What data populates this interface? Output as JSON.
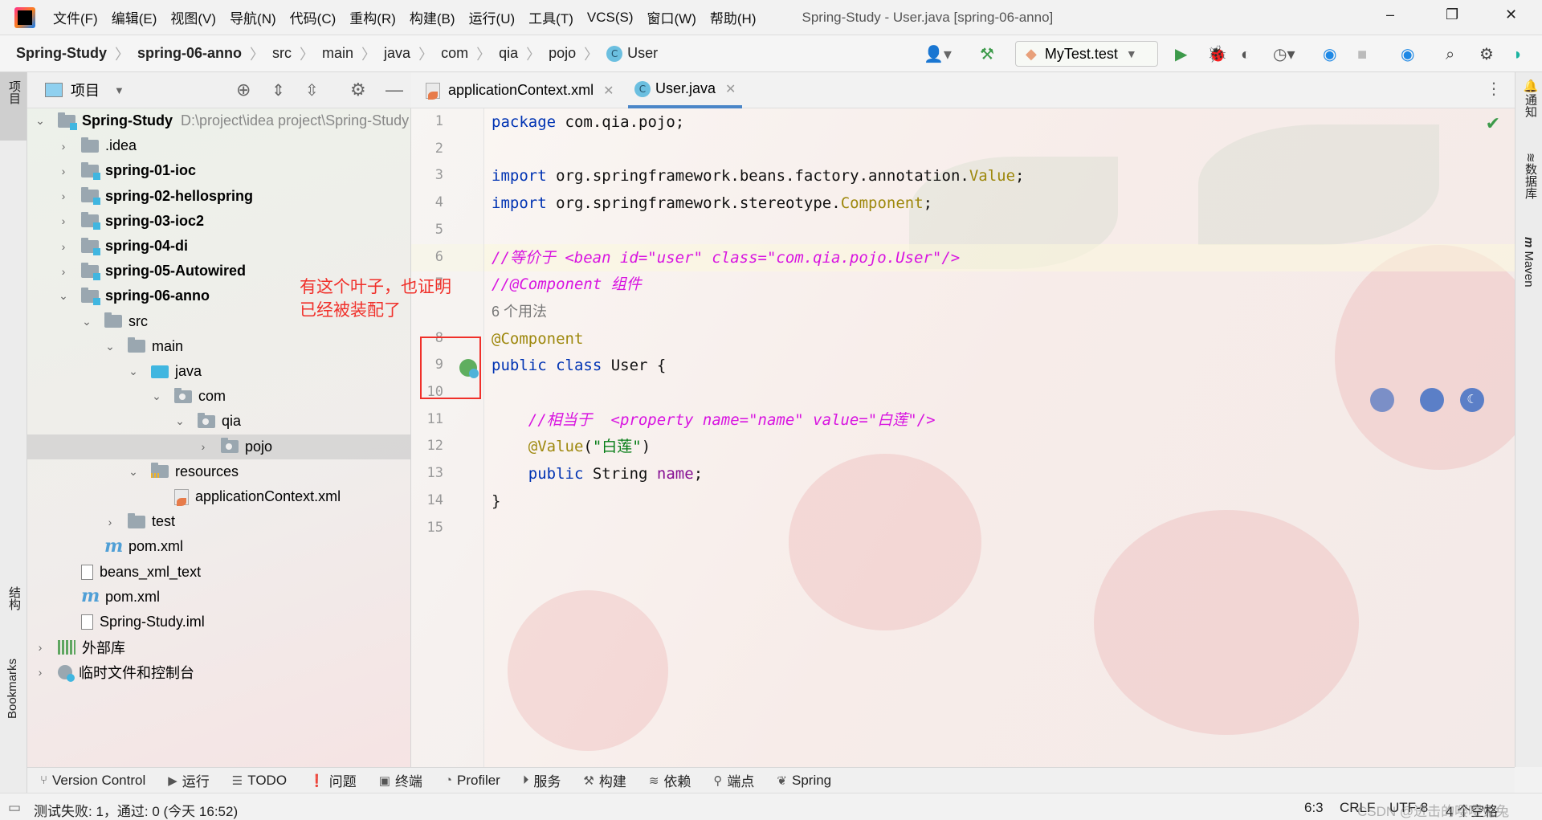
{
  "titlebar": {
    "menus": [
      "文件(F)",
      "编辑(E)",
      "视图(V)",
      "导航(N)",
      "代码(C)",
      "重构(R)",
      "构建(B)",
      "运行(U)",
      "工具(T)",
      "VCS(S)",
      "窗口(W)",
      "帮助(H)"
    ],
    "window_title": "Spring-Study - User.java [spring-06-anno]"
  },
  "breadcrumb": [
    "Spring-Study",
    "spring-06-anno",
    "src",
    "main",
    "java",
    "com",
    "qia",
    "pojo",
    "User"
  ],
  "toolbar": {
    "run_config": "MyTest.test"
  },
  "left_strip": {
    "project": "项目",
    "structure": "结构",
    "bookmarks": "Bookmarks"
  },
  "right_strip": {
    "notifications": "通知",
    "database": "数据库",
    "maven": "Maven"
  },
  "project_panel": {
    "title": "项目",
    "tree": [
      {
        "label": "Spring-Study",
        "path": "D:\\project\\idea project\\Spring-Study",
        "level": 0,
        "arrow": "down",
        "icon": "module",
        "bold": true
      },
      {
        "label": ".idea",
        "level": 1,
        "arrow": "right",
        "icon": "folder"
      },
      {
        "label": "spring-01-ioc",
        "level": 1,
        "arrow": "right",
        "icon": "module",
        "bold": true
      },
      {
        "label": "spring-02-hellospring",
        "level": 1,
        "arrow": "right",
        "icon": "module",
        "bold": true
      },
      {
        "label": "spring-03-ioc2",
        "level": 1,
        "arrow": "right",
        "icon": "module",
        "bold": true
      },
      {
        "label": "spring-04-di",
        "level": 1,
        "arrow": "right",
        "icon": "module",
        "bold": true
      },
      {
        "label": "spring-05-Autowired",
        "level": 1,
        "arrow": "right",
        "icon": "module",
        "bold": true
      },
      {
        "label": "spring-06-anno",
        "level": 1,
        "arrow": "down",
        "icon": "module",
        "bold": true
      },
      {
        "label": "src",
        "level": 2,
        "arrow": "down",
        "icon": "folder"
      },
      {
        "label": "main",
        "level": 3,
        "arrow": "down",
        "icon": "folder"
      },
      {
        "label": "java",
        "level": 4,
        "arrow": "down",
        "icon": "srcfolder"
      },
      {
        "label": "com",
        "level": 5,
        "arrow": "down",
        "icon": "pkg"
      },
      {
        "label": "qia",
        "level": 6,
        "arrow": "down",
        "icon": "pkg"
      },
      {
        "label": "pojo",
        "level": 7,
        "arrow": "right",
        "icon": "pkg",
        "selected": true
      },
      {
        "label": "resources",
        "level": 4,
        "arrow": "down",
        "icon": "res"
      },
      {
        "label": "applicationContext.xml",
        "level": 5,
        "arrow": "none",
        "icon": "xml"
      },
      {
        "label": "test",
        "level": 3,
        "arrow": "right",
        "icon": "folder"
      },
      {
        "label": "pom.xml",
        "level": 2,
        "arrow": "none",
        "icon": "maven"
      },
      {
        "label": "beans_xml_text",
        "level": 1,
        "arrow": "none",
        "icon": "text"
      },
      {
        "label": "pom.xml",
        "level": 1,
        "arrow": "none",
        "icon": "maven"
      },
      {
        "label": "Spring-Study.iml",
        "level": 1,
        "arrow": "none",
        "icon": "text"
      },
      {
        "label": "外部库",
        "level": 0,
        "arrow": "right",
        "icon": "lib"
      },
      {
        "label": "临时文件和控制台",
        "level": 0,
        "arrow": "right",
        "icon": "scratch"
      }
    ]
  },
  "tabs": [
    {
      "label": "applicationContext.xml",
      "icon": "xml-icon",
      "active": false
    },
    {
      "label": "User.java",
      "icon": "class-icon",
      "active": true
    }
  ],
  "editor": {
    "current_line": 6,
    "lines": [
      [
        {
          "t": "package ",
          "c": "kw"
        },
        {
          "t": "com.qia.pojo;",
          "c": "pl"
        }
      ],
      [],
      [
        {
          "t": "import ",
          "c": "kw"
        },
        {
          "t": "org.springframework.beans.factory.annotation.",
          "c": "pl"
        },
        {
          "t": "Value",
          "c": "ann"
        },
        {
          "t": ";",
          "c": "pl"
        }
      ],
      [
        {
          "t": "import ",
          "c": "kw"
        },
        {
          "t": "org.springframework.stereotype.",
          "c": "pl"
        },
        {
          "t": "Component",
          "c": "ann"
        },
        {
          "t": ";",
          "c": "pl"
        }
      ],
      [],
      [
        {
          "t": "//等价于 <bean id=\"user\" class=\"com.qia.pojo.User\"/>",
          "c": "cm"
        }
      ],
      [
        {
          "t": "//@Component 组件",
          "c": "cm"
        }
      ],
      [
        {
          "t": "6 个用法",
          "c": "hint"
        }
      ],
      [
        {
          "t": "@Component",
          "c": "ann"
        }
      ],
      [
        {
          "t": "public class ",
          "c": "kw"
        },
        {
          "t": "User {",
          "c": "pl"
        }
      ],
      [],
      [
        {
          "t": "    //相当于  <property name=\"name\" value=\"白莲\"/>",
          "c": "cm"
        }
      ],
      [
        {
          "t": "    @Value",
          "c": "ann"
        },
        {
          "t": "(",
          "c": "pl"
        },
        {
          "t": "\"白莲\"",
          "c": "str"
        },
        {
          "t": ")",
          "c": "pl"
        }
      ],
      [
        {
          "t": "    public ",
          "c": "kw"
        },
        {
          "t": "String ",
          "c": "pl"
        },
        {
          "t": "name",
          "c": "fld"
        },
        {
          "t": ";",
          "c": "pl"
        }
      ],
      [
        {
          "t": "}",
          "c": "pl"
        }
      ],
      []
    ],
    "line_numbers": [
      "1",
      "2",
      "3",
      "4",
      "5",
      "6",
      "7",
      "8",
      "9",
      "10",
      "11",
      "12",
      "13",
      "14",
      "15"
    ]
  },
  "annotation": {
    "line1": "有这个叶子，也证明",
    "line2": "已经被装配了"
  },
  "bottom_tools": [
    "Version Control",
    "运行",
    "TODO",
    "问题",
    "终端",
    "Profiler",
    "服务",
    "构建",
    "依赖",
    "端点",
    "Spring"
  ],
  "status": {
    "message": "测试失败: 1，通过: 0 (今天 16:52)",
    "position": "6:3",
    "line_ending": "CRLF",
    "encoding": "UTF-8",
    "indent": "4 个空格"
  },
  "watermark": "CSDN @进击的嘤嘤兔兔"
}
